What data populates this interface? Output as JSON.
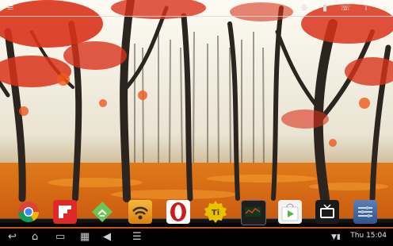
{
  "system_bar": {
    "time": "Thu 15:04"
  },
  "dock_apps": [
    {
      "name": "Chrome",
      "color": "#dd4b39"
    },
    {
      "name": "Flipboard",
      "color": "#e12828"
    },
    {
      "name": "Feedly",
      "color": "#6cc655"
    },
    {
      "name": "WiFi Analyzer",
      "color": "#f0a020"
    },
    {
      "name": "Opera",
      "color": "#cc1b1b"
    },
    {
      "name": "Titanium Backup",
      "color": "#e6c200"
    },
    {
      "name": "DSLR Controller",
      "color": "#2b2b2b"
    },
    {
      "name": "Play Store",
      "color": "#4db94a"
    },
    {
      "name": "TV Player",
      "color": "#f5a000"
    },
    {
      "name": "Settings",
      "color": "#4a6ea8"
    }
  ],
  "colors": {
    "sky_top": "#fefcf4",
    "foliage_red": "#d9321a",
    "ground_orange": "#e8650e"
  }
}
